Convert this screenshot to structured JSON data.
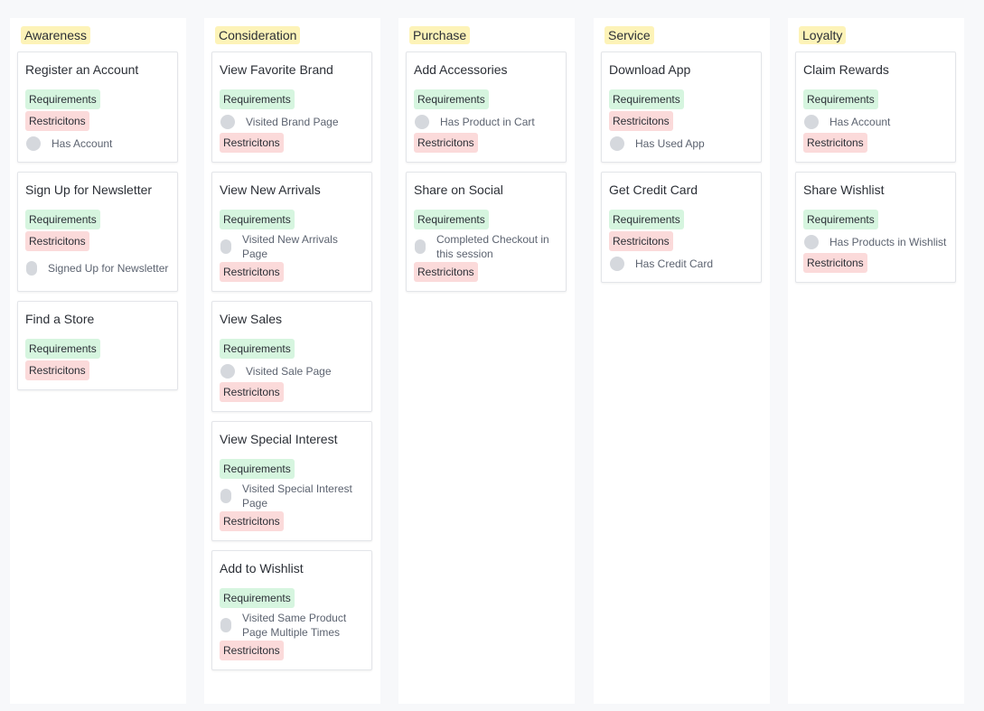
{
  "columns": [
    {
      "title": "Awareness",
      "cards": [
        {
          "title": "Register an Account",
          "rows": [
            {
              "kind": "req",
              "text": "Requirements"
            },
            {
              "kind": "res",
              "text": "Restricitons"
            },
            {
              "kind": "cond",
              "text": "Has Account"
            }
          ]
        },
        {
          "title": "Sign Up for Newsletter",
          "rows": [
            {
              "kind": "req",
              "text": "Requirements"
            },
            {
              "kind": "res",
              "text": "Restricitons"
            },
            {
              "kind": "cond",
              "text": "Signed Up for Newsletter",
              "wrap": true
            }
          ]
        },
        {
          "title": "Find a Store",
          "rows": [
            {
              "kind": "req",
              "text": "Requirements"
            },
            {
              "kind": "res",
              "text": "Restricitons"
            }
          ]
        }
      ]
    },
    {
      "title": "Consideration",
      "cards": [
        {
          "title": "View Favorite Brand",
          "rows": [
            {
              "kind": "req",
              "text": "Requirements"
            },
            {
              "kind": "cond",
              "text": "Visited Brand Page"
            },
            {
              "kind": "res",
              "text": "Restricitons"
            }
          ]
        },
        {
          "title": "View New Arrivals",
          "rows": [
            {
              "kind": "req",
              "text": "Requirements"
            },
            {
              "kind": "cond",
              "text": "Visited New Arrivals Page",
              "wrap": true
            },
            {
              "kind": "res",
              "text": "Restricitons"
            }
          ]
        },
        {
          "title": "View Sales",
          "rows": [
            {
              "kind": "req",
              "text": "Requirements"
            },
            {
              "kind": "cond",
              "text": "Visited Sale Page"
            },
            {
              "kind": "res",
              "text": "Restricitons"
            }
          ]
        },
        {
          "title": "View Special Interest",
          "rows": [
            {
              "kind": "req",
              "text": "Requirements"
            },
            {
              "kind": "cond",
              "text": "Visited Special Interest Page",
              "wrap": true
            },
            {
              "kind": "res",
              "text": "Restricitons"
            }
          ]
        },
        {
          "title": "Add to Wishlist",
          "rows": [
            {
              "kind": "req",
              "text": "Requirements"
            },
            {
              "kind": "cond",
              "text": "Visited Same Product Page Multiple Times",
              "wrap": true
            },
            {
              "kind": "res",
              "text": "Restricitons"
            }
          ]
        }
      ]
    },
    {
      "title": "Purchase",
      "cards": [
        {
          "title": "Add Accessories",
          "rows": [
            {
              "kind": "req",
              "text": "Requirements"
            },
            {
              "kind": "cond",
              "text": "Has Product in Cart"
            },
            {
              "kind": "res",
              "text": "Restricitons"
            }
          ]
        },
        {
          "title": "Share on Social",
          "rows": [
            {
              "kind": "req",
              "text": "Requirements"
            },
            {
              "kind": "cond",
              "text": "Completed Checkout in this session",
              "wrap": true
            },
            {
              "kind": "res",
              "text": "Restricitons"
            }
          ]
        }
      ]
    },
    {
      "title": "Service",
      "cards": [
        {
          "title": "Download App",
          "rows": [
            {
              "kind": "req",
              "text": "Requirements"
            },
            {
              "kind": "res",
              "text": "Restricitons"
            },
            {
              "kind": "cond",
              "text": "Has Used App"
            }
          ]
        },
        {
          "title": "Get Credit Card",
          "rows": [
            {
              "kind": "req",
              "text": "Requirements"
            },
            {
              "kind": "res",
              "text": "Restricitons"
            },
            {
              "kind": "cond",
              "text": "Has Credit Card"
            }
          ]
        }
      ]
    },
    {
      "title": "Loyalty",
      "cards": [
        {
          "title": "Claim Rewards",
          "rows": [
            {
              "kind": "req",
              "text": "Requirements"
            },
            {
              "kind": "cond",
              "text": "Has Account"
            },
            {
              "kind": "res",
              "text": "Restricitons"
            }
          ]
        },
        {
          "title": "Share Wishlist",
          "rows": [
            {
              "kind": "req",
              "text": "Requirements"
            },
            {
              "kind": "cond",
              "text": "Has Products in Wishlist"
            },
            {
              "kind": "res",
              "text": "Restricitons"
            }
          ]
        }
      ]
    }
  ]
}
